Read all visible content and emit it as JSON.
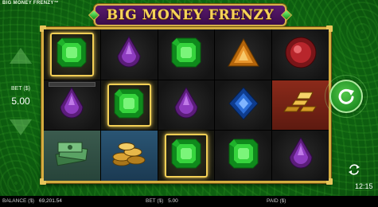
{
  "game": {
    "title": "BIG MONEY FRENZY™",
    "logo_text": "BIG MONEY FRENZY"
  },
  "bet_panel": {
    "label": "BET ($)",
    "value": "5.00"
  },
  "reels": [
    [
      {
        "symbol": "green-emerald-icon",
        "highlight": true,
        "bg": "dark"
      },
      {
        "symbol": "purple-drop-gem-icon",
        "highlight": false,
        "bg": "dark"
      },
      {
        "symbol": "money-stack-icon",
        "highlight": false,
        "bg": "money"
      }
    ],
    [
      {
        "symbol": "purple-drop-gem-icon",
        "highlight": false,
        "bg": "dark"
      },
      {
        "symbol": "green-emerald-icon",
        "highlight": true,
        "bg": "dark"
      },
      {
        "symbol": "gold-coins-icon",
        "highlight": false,
        "bg": "coins"
      }
    ],
    [
      {
        "symbol": "green-emerald-icon",
        "highlight": false,
        "bg": "dark"
      },
      {
        "symbol": "purple-drop-gem-icon",
        "highlight": false,
        "bg": "dark"
      },
      {
        "symbol": "green-emerald-icon",
        "highlight": true,
        "bg": "dark"
      }
    ],
    [
      {
        "symbol": "orange-triangle-gem-icon",
        "highlight": false,
        "bg": "dark"
      },
      {
        "symbol": "blue-diamond-gem-icon",
        "highlight": false,
        "bg": "dark"
      },
      {
        "symbol": "green-emerald-icon",
        "highlight": false,
        "bg": "dark"
      }
    ],
    [
      {
        "symbol": "red-round-gem-icon",
        "highlight": false,
        "bg": "dark"
      },
      {
        "symbol": "gold-bars-icon",
        "highlight": false,
        "bg": "gold"
      },
      {
        "symbol": "purple-drop-gem-icon",
        "highlight": false,
        "bg": "dark"
      }
    ]
  ],
  "status_bar": {
    "balance_label": "BALANCE ($)",
    "balance_value": "69,201.54",
    "bet_label": "BET ($)",
    "bet_value": "5.00",
    "paid_label": "PAID ($)",
    "paid_value": ""
  },
  "clock": "12:15",
  "colors": {
    "table_green": "#0f6a12",
    "frame_gold": "#d4ad3f",
    "highlight_gold": "#f2cf55"
  }
}
